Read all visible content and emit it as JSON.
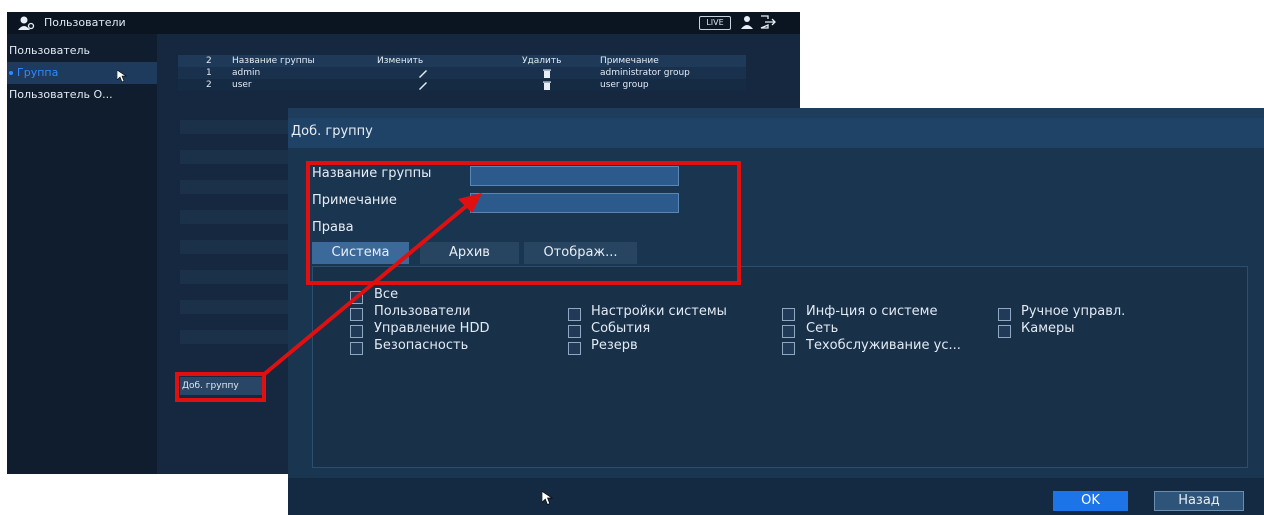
{
  "background_window": {
    "title": "Пользователи",
    "live_badge": "LIVE",
    "sidebar": {
      "items": [
        {
          "label": "Пользователь",
          "active": false
        },
        {
          "label": "Группа",
          "active": true
        },
        {
          "label": "Пользователь О...",
          "active": false
        }
      ]
    },
    "table": {
      "headers": [
        "2",
        "Название группы",
        "Изменить",
        "Удалить",
        "Примечание"
      ],
      "rows": [
        {
          "num": "1",
          "name": "admin",
          "edit": "✎",
          "delete": "🗑",
          "note": "administrator group"
        },
        {
          "num": "2",
          "name": "user",
          "edit": "✎",
          "delete": "🗑",
          "note": "user group"
        }
      ]
    },
    "add_group_button": "Доб. группу"
  },
  "dialog": {
    "title": "Доб. группу",
    "group_name_label": "Название группы",
    "group_name_value": "",
    "note_label": "Примечание",
    "note_value": "",
    "rights_label": "Права",
    "tabs": [
      {
        "label": "Система",
        "active": true
      },
      {
        "label": "Архив",
        "active": false
      },
      {
        "label": "Отображ...",
        "active": false
      }
    ],
    "permissions": {
      "all": "Все",
      "items": [
        "Пользователи",
        "Настройки системы",
        "Инф-ция о системе",
        "Ручное управл.",
        "Управление HDD",
        "События",
        "Сеть",
        "Камеры",
        "Безопасность",
        "Резерв",
        "Техобслуживание ус..."
      ]
    },
    "ok_button": "OK",
    "back_button": "Назад"
  },
  "colors": {
    "accent_blue": "#1c74e8",
    "annotation_red": "#e01010",
    "panel_dark": "#13253b"
  }
}
